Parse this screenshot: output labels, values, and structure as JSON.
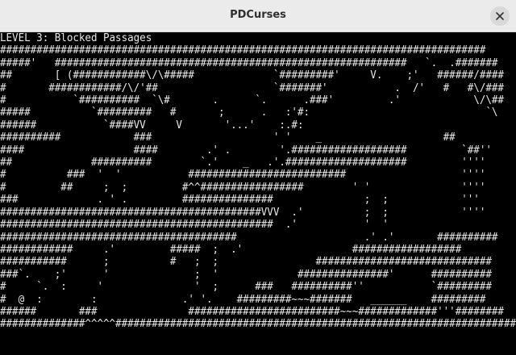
{
  "window": {
    "title": "PDCurses",
    "close_icon": "close-icon"
  },
  "terminal": {
    "foreground": "#e8e8e8",
    "background": "#000000",
    "lines": [
      "LEVEL 3: Blocked Passages",
      "################################################################################",
      "#####'   ##########################################################   `.  .#######",
      "##       [ (############\\/\\#####             `#########'     V.    ;'   ######/####",
      "#       ############/\\/'##                   `#######'           .  /'   #   #\\/###",
      "#           `##########  `\\#       .      `.      .###'         .'            \\/\\##",
      "#####          `#########   #       ;      .   :'#:                             `\\",
      "######           `####VV     V       '...'    :.#:                             ",
      "##########            ###                    ' '    _                    ##     ",
      "####                  ####        .' .        '.###################         `##''",
      "##             ##########        `.'    _   .'.####################         ''''",
      "#          ###  '  '           ##########################                   ''''",
      "#         ##     ;  ;         #^^#################        ' '               ''''",
      "###             . ' .         ###############               ;  ;            '''",
      "###########################################VVV  .'          ;  ;            ''''",
      "#############################################  .'           '  '             ",
      "#######################################                     .' .'       ##########",
      "############     .'         #####  ;  .'                  ##################",
      "###########      ;          #   ;  ;                #############################",
      "###`.    ;'      '              ;  '             ###############'      ##########",
      "#     `.  :     '               '  ;      ###   ##########''           `#########",
      "#  @  :        :              .' '.    #########~~~#######   ______    #########",
      "######       ###               #########################~~~#############'''########",
      "##############^^^^^##################################################################"
    ]
  }
}
